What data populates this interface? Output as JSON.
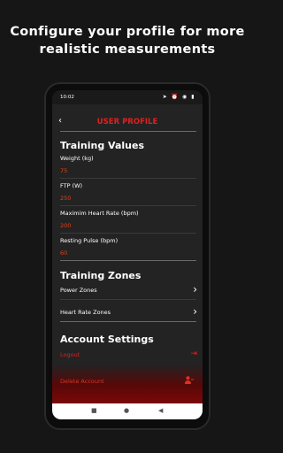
{
  "promo": {
    "line1": "Configure your profile for more",
    "line2": "realistic measurements"
  },
  "status": {
    "time": "10:02",
    "icons": "➤ ⏰ ◉ ▮"
  },
  "header": {
    "back": "‹",
    "title": "USER PROFILE"
  },
  "training_values": {
    "heading": "Training Values",
    "fields": [
      {
        "label": "Weight (kg)",
        "value": "75"
      },
      {
        "label": "FTP (W)",
        "value": "250"
      },
      {
        "label": "Maximim Heart Rate (bpm)",
        "value": "200"
      },
      {
        "label": "Resting Pulse (bpm)",
        "value": "60"
      }
    ]
  },
  "training_zones": {
    "heading": "Training Zones",
    "items": [
      {
        "label": "Power Zones"
      },
      {
        "label": "Heart Rate Zones"
      }
    ]
  },
  "account": {
    "heading": "Account Settings",
    "logout": "Logout",
    "delete": "Delete Account"
  },
  "icons": {
    "chevron": "›",
    "logout_icon": "⇥",
    "delete_icon": "👤"
  },
  "nav": {
    "square": "■",
    "circle": "●",
    "back": "◀"
  },
  "colors": {
    "accent": "#e0201e",
    "value": "#e0401a",
    "background": "#161616"
  }
}
